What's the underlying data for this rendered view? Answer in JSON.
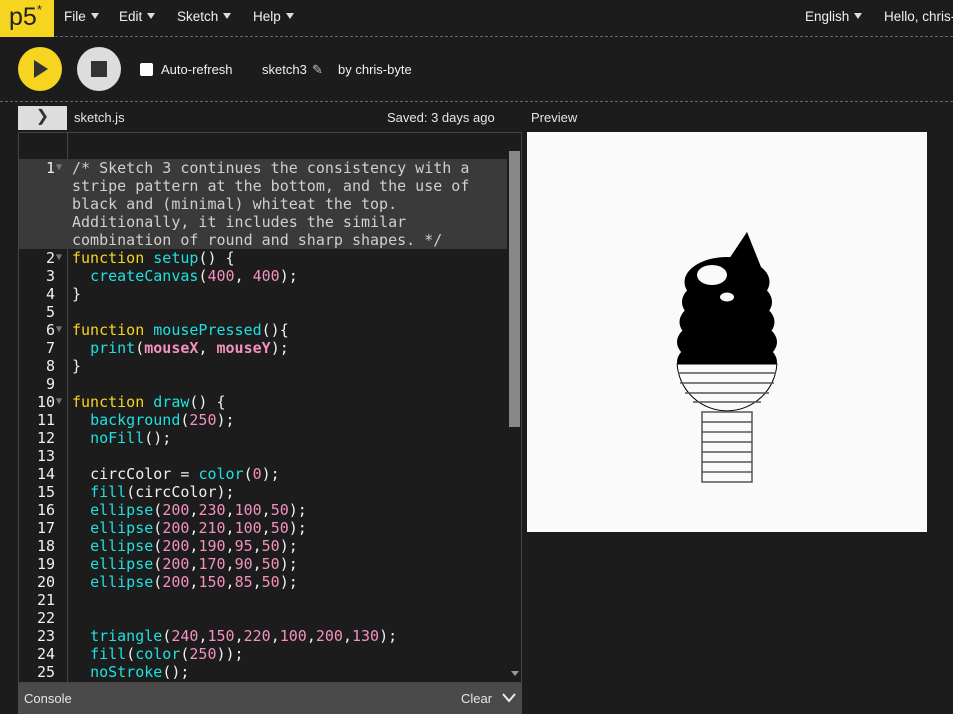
{
  "nav": {
    "logo": "p5",
    "logo_sup": "*",
    "menus": [
      "File",
      "Edit",
      "Sketch",
      "Help"
    ],
    "language": "English",
    "user": "Hello, chris-"
  },
  "toolbar": {
    "auto_refresh_label": "Auto-refresh",
    "auto_refresh_checked": false,
    "sketch_name": "sketch3",
    "author": "by chris-byte"
  },
  "file": {
    "name": "sketch.js",
    "saved": "Saved: 3 days ago"
  },
  "preview": {
    "label": "Preview"
  },
  "console": {
    "label": "Console",
    "clear": "Clear"
  },
  "colors": {
    "accent": "#f5d51f",
    "keyword": "#f5d51f",
    "function": "#1fe0e0",
    "number": "#f392bf",
    "background": "#1c1c1c"
  },
  "code": [
    {
      "n": "1",
      "fold": true,
      "sel": true,
      "t": [
        [
          "/* Sketch 3 continues the consistency with a stripe pattern at the bottom, and the use of black and (minimal) whiteat the top. Additionally, it includes the similar combination of round and sharp shapes. */",
          "comment"
        ]
      ]
    },
    {
      "n": "2",
      "fold": true,
      "t": [
        [
          "function",
          "kw"
        ],
        [
          " ",
          ""
        ],
        [
          "setup",
          "fn"
        ],
        [
          "() {",
          ""
        ]
      ]
    },
    {
      "n": "3",
      "t": [
        [
          "  ",
          ""
        ],
        [
          "createCanvas",
          "fn"
        ],
        [
          "(",
          ""
        ],
        [
          "400",
          "num-lit"
        ],
        [
          ", ",
          ""
        ],
        [
          "400",
          "num-lit"
        ],
        [
          ");",
          ""
        ]
      ]
    },
    {
      "n": "4",
      "t": [
        [
          "}",
          ""
        ]
      ]
    },
    {
      "n": "5",
      "t": []
    },
    {
      "n": "6",
      "fold": true,
      "t": [
        [
          "function",
          "kw"
        ],
        [
          " ",
          ""
        ],
        [
          "mousePressed",
          "fn"
        ],
        [
          "(){",
          ""
        ]
      ]
    },
    {
      "n": "7",
      "t": [
        [
          "  ",
          ""
        ],
        [
          "print",
          "fn"
        ],
        [
          "(",
          ""
        ],
        [
          "mouseX",
          "var"
        ],
        [
          ", ",
          ""
        ],
        [
          "mouseY",
          "var"
        ],
        [
          ");",
          ""
        ]
      ]
    },
    {
      "n": "8",
      "t": [
        [
          "}",
          ""
        ]
      ]
    },
    {
      "n": "9",
      "t": []
    },
    {
      "n": "10",
      "fold": true,
      "t": [
        [
          "function",
          "kw"
        ],
        [
          " ",
          ""
        ],
        [
          "draw",
          "fn"
        ],
        [
          "() {",
          ""
        ]
      ]
    },
    {
      "n": "11",
      "t": [
        [
          "  ",
          ""
        ],
        [
          "background",
          "fn"
        ],
        [
          "(",
          ""
        ],
        [
          "250",
          "num-lit"
        ],
        [
          ");",
          ""
        ]
      ]
    },
    {
      "n": "12",
      "t": [
        [
          "  ",
          ""
        ],
        [
          "noFill",
          "fn"
        ],
        [
          "();",
          ""
        ]
      ]
    },
    {
      "n": "13",
      "t": []
    },
    {
      "n": "14",
      "t": [
        [
          "  circColor = ",
          ""
        ],
        [
          "color",
          "fn"
        ],
        [
          "(",
          ""
        ],
        [
          "0",
          "num-lit"
        ],
        [
          ");",
          ""
        ]
      ]
    },
    {
      "n": "15",
      "t": [
        [
          "  ",
          ""
        ],
        [
          "fill",
          "fn"
        ],
        [
          "(circColor);",
          ""
        ]
      ]
    },
    {
      "n": "16",
      "t": [
        [
          "  ",
          ""
        ],
        [
          "ellipse",
          "fn"
        ],
        [
          "(",
          ""
        ],
        [
          "200",
          "num-lit"
        ],
        [
          ",",
          ""
        ],
        [
          "230",
          "num-lit"
        ],
        [
          ",",
          ""
        ],
        [
          "100",
          "num-lit"
        ],
        [
          ",",
          ""
        ],
        [
          "50",
          "num-lit"
        ],
        [
          ");",
          ""
        ]
      ]
    },
    {
      "n": "17",
      "t": [
        [
          "  ",
          ""
        ],
        [
          "ellipse",
          "fn"
        ],
        [
          "(",
          ""
        ],
        [
          "200",
          "num-lit"
        ],
        [
          ",",
          ""
        ],
        [
          "210",
          "num-lit"
        ],
        [
          ",",
          ""
        ],
        [
          "100",
          "num-lit"
        ],
        [
          ",",
          ""
        ],
        [
          "50",
          "num-lit"
        ],
        [
          ");",
          ""
        ]
      ]
    },
    {
      "n": "18",
      "t": [
        [
          "  ",
          ""
        ],
        [
          "ellipse",
          "fn"
        ],
        [
          "(",
          ""
        ],
        [
          "200",
          "num-lit"
        ],
        [
          ",",
          ""
        ],
        [
          "190",
          "num-lit"
        ],
        [
          ",",
          ""
        ],
        [
          "95",
          "num-lit"
        ],
        [
          ",",
          ""
        ],
        [
          "50",
          "num-lit"
        ],
        [
          ");",
          ""
        ]
      ]
    },
    {
      "n": "19",
      "t": [
        [
          "  ",
          ""
        ],
        [
          "ellipse",
          "fn"
        ],
        [
          "(",
          ""
        ],
        [
          "200",
          "num-lit"
        ],
        [
          ",",
          ""
        ],
        [
          "170",
          "num-lit"
        ],
        [
          ",",
          ""
        ],
        [
          "90",
          "num-lit"
        ],
        [
          ",",
          ""
        ],
        [
          "50",
          "num-lit"
        ],
        [
          ");",
          ""
        ]
      ]
    },
    {
      "n": "20",
      "t": [
        [
          "  ",
          ""
        ],
        [
          "ellipse",
          "fn"
        ],
        [
          "(",
          ""
        ],
        [
          "200",
          "num-lit"
        ],
        [
          ",",
          ""
        ],
        [
          "150",
          "num-lit"
        ],
        [
          ",",
          ""
        ],
        [
          "85",
          "num-lit"
        ],
        [
          ",",
          ""
        ],
        [
          "50",
          "num-lit"
        ],
        [
          ");",
          ""
        ]
      ]
    },
    {
      "n": "21",
      "t": []
    },
    {
      "n": "22",
      "t": []
    },
    {
      "n": "23",
      "t": [
        [
          "  ",
          ""
        ],
        [
          "triangle",
          "fn"
        ],
        [
          "(",
          ""
        ],
        [
          "240",
          "num-lit"
        ],
        [
          ",",
          ""
        ],
        [
          "150",
          "num-lit"
        ],
        [
          ",",
          ""
        ],
        [
          "220",
          "num-lit"
        ],
        [
          ",",
          ""
        ],
        [
          "100",
          "num-lit"
        ],
        [
          ",",
          ""
        ],
        [
          "200",
          "num-lit"
        ],
        [
          ",",
          ""
        ],
        [
          "130",
          "num-lit"
        ],
        [
          ");",
          ""
        ]
      ]
    },
    {
      "n": "24",
      "t": [
        [
          "  ",
          ""
        ],
        [
          "fill",
          "fn"
        ],
        [
          "(",
          ""
        ],
        [
          "color",
          "fn"
        ],
        [
          "(",
          ""
        ],
        [
          "250",
          "num-lit"
        ],
        [
          "));",
          ""
        ]
      ]
    },
    {
      "n": "25",
      "t": [
        [
          "  ",
          ""
        ],
        [
          "noStroke",
          "fn"
        ],
        [
          "();",
          ""
        ]
      ]
    }
  ]
}
